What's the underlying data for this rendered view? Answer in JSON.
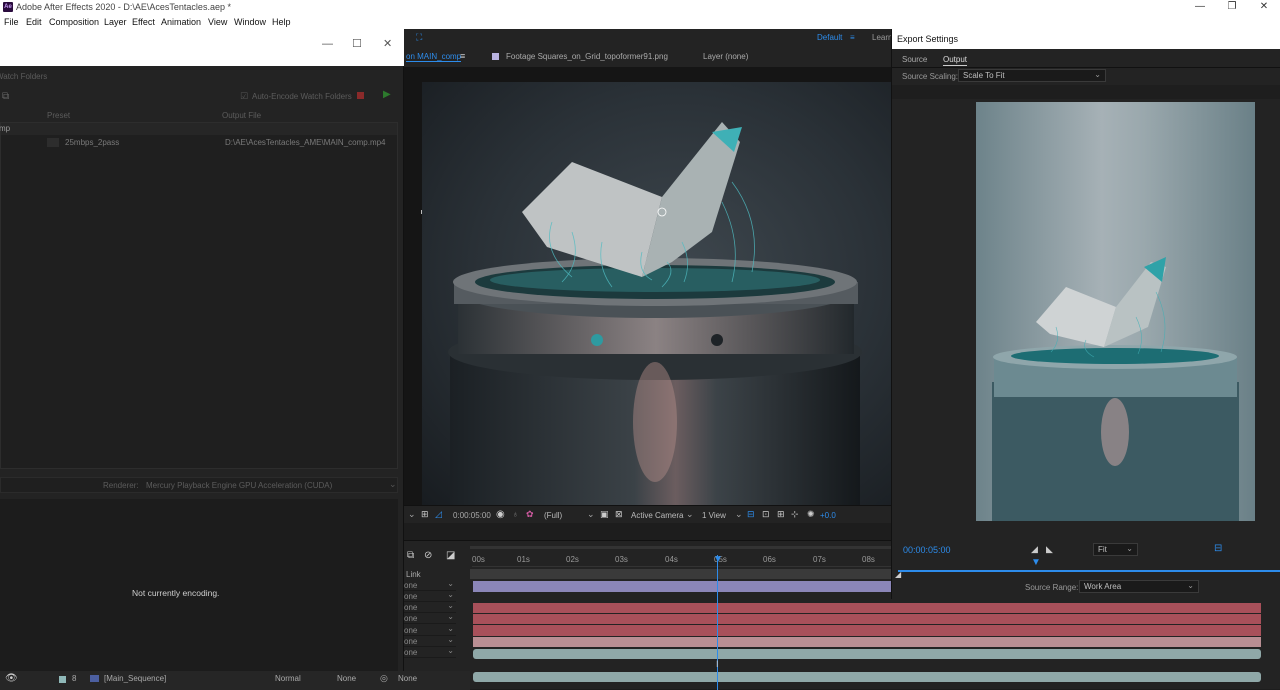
{
  "titlebar": {
    "title": "Adobe After Effects 2020 - D:\\AE\\AcesTentacles.aep *",
    "logo": "Ae"
  },
  "menu": [
    "File",
    "Edit",
    "Composition",
    "Layer",
    "Effect",
    "Animation",
    "View",
    "Window",
    "Help"
  ],
  "workspace": {
    "default": "Default",
    "learn": "Learn"
  },
  "ame": {
    "watch_folders": "Watch Folders",
    "auto_encode": "Auto-Encode Watch Folders",
    "col_preset": "Preset",
    "col_output": "Output File",
    "group_label": "mp",
    "preset_value": "25mbps_2pass",
    "output_value": "D:\\AE\\AcesTentacles_AME\\MAIN_comp.mp4",
    "renderer_label": "Renderer:",
    "renderer_value": "Mercury Playback Engine GPU Acceleration (CUDA)",
    "status": "Not currently encoding."
  },
  "comp_tabs": {
    "composition": "on MAIN_comp",
    "footage": "Footage Squares_on_Grid_topoformer91.png",
    "layer": "Layer (none)"
  },
  "viewer_bar": {
    "timecode": "0:00:05:00",
    "resolution": "(Full)",
    "camera": "Active Camera",
    "views": "1 View",
    "exposure": "+0.0"
  },
  "timeline": {
    "ticks": [
      "00s",
      "01s",
      "02s",
      "03s",
      "04s",
      "05s",
      "06s",
      "07s",
      "08s"
    ],
    "link_header": "Link",
    "link_values": [
      "one",
      "one",
      "one",
      "one",
      "one",
      "one",
      "one"
    ],
    "bottom_row": {
      "layer_num": "8",
      "layer_name": "[Main_Sequence]",
      "mode": "Normal",
      "trkmat": "None",
      "parent": "None"
    },
    "colors": {
      "purple": "#8b86b8",
      "red": "#a8505a",
      "pink": "#b98e93",
      "teal": "#8fa8a8"
    }
  },
  "export": {
    "title": "Export Settings",
    "tab_source": "Source",
    "tab_output": "Output",
    "scaling_label": "Source Scaling:",
    "scaling_value": "Scale To Fit",
    "timecode": "00:00:05:00",
    "fit": "Fit",
    "range_label": "Source Range:",
    "range_value": "Work Area",
    "accent": "#2d8ceb"
  }
}
